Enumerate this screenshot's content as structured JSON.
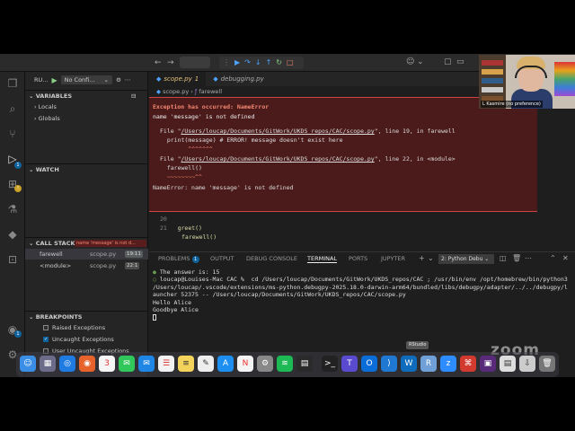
{
  "run_sidebar": {
    "title": "RU...",
    "config": "No Confi...",
    "sections": {
      "variables": "VARIABLES",
      "locals": "Locals",
      "globals": "Globals",
      "watch": "WATCH",
      "call_stack": "CALL STACK",
      "call_stack_error": "name 'message' is not d...",
      "breakpoints": "BREAKPOINTS"
    },
    "call_stack": [
      {
        "fn": "farewell",
        "file": "scope.py",
        "line": "19:11"
      },
      {
        "fn": "<module>",
        "file": "scope.py",
        "line": "22:1"
      }
    ],
    "breakpoints": [
      {
        "label": "Raised Exceptions",
        "checked": false
      },
      {
        "label": "Uncaught Exceptions",
        "checked": true
      },
      {
        "label": "User Uncaught Exceptions",
        "checked": false
      }
    ]
  },
  "tabs": [
    {
      "label": "scope.py",
      "badge": "1",
      "active": true
    },
    {
      "label": "debugging.py",
      "active": false
    }
  ],
  "breadcrumb": {
    "file": "scope.py",
    "symbol": "farewell"
  },
  "exception": {
    "title": "Exception has occurred: NameError",
    "message": "name 'message' is not defined",
    "tb1_prefix": "File \"",
    "tb1_path": "/Users/loucap/Documents/GitWork/UKDS_repos/CAC/scope.py",
    "tb1_suffix": "\", line 19, in farewell",
    "tb1_code": "  print(message) # ERROR! message doesn't exist here",
    "tb1_caret": "        ^^^^^^^",
    "tb2_prefix": "File \"",
    "tb2_path": "/Users/loucap/Documents/GitWork/UKDS_repos/CAC/scope.py",
    "tb2_suffix": "\", line 22, in <module>",
    "tb2_code": "  farewell()",
    "tb2_caret": "  ~~~~~~~~^^",
    "final": "NameError: name 'message' is not defined"
  },
  "code": {
    "line20_num": "20",
    "line21_num": "21",
    "line21_code": "greet()",
    "line22_code": "farewell()"
  },
  "panel": {
    "tabs": {
      "problems": "PROBLEMS",
      "problems_badge": "1",
      "output": "OUTPUT",
      "debug_console": "DEBUG CONSOLE",
      "terminal": "TERMINAL",
      "ports": "PORTS",
      "jupyter": "JUPYTER"
    },
    "terminal_select": "2: Python Debu",
    "terminal_lines": {
      "l1": "The answer is: 15",
      "l2": "loucap@Louises-Mac CAC %  cd /Users/loucap/Documents/GitWork/UKDS_repos/CAC ; /usr/bin/env /opt/homebrew/bin/python3 /Users/loucap/.vscode/extensions/ms-python.debugpy-2025.18.0-darwin-arm64/bundled/libs/debugpy/adapter/../../debugpy/launcher 52375 -- /Users/loucap/Documents/GitWork/UKDS_repos/CAC/scope.py",
      "l3": "Hello Alice",
      "l4": "Goodbye Alice"
    }
  },
  "video": {
    "label": "L Kasmire (no preference)"
  },
  "dock": {
    "calendar_day": "3",
    "tooltip": "RStudio",
    "watermark": "zoom"
  },
  "colors": {
    "exception_bg": "#4b1b1b",
    "accent": "#0e639c",
    "error_text": "#f48771"
  }
}
